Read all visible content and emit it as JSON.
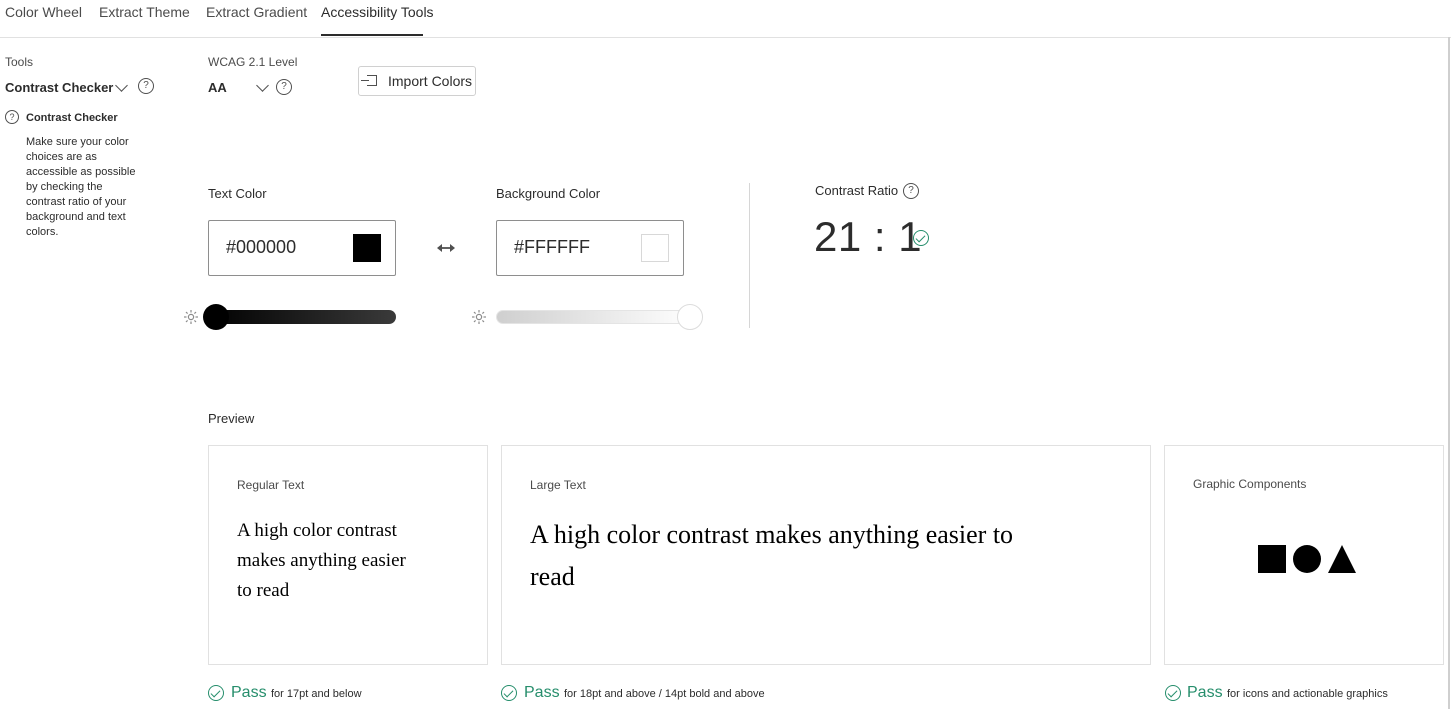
{
  "tabs": [
    {
      "label": "Color Wheel"
    },
    {
      "label": "Extract Theme"
    },
    {
      "label": "Extract Gradient"
    },
    {
      "label": "Accessibility Tools"
    }
  ],
  "active_tab": "Accessibility Tools",
  "tools": {
    "label": "Tools",
    "selected": "Contrast Checker",
    "help_title": "Contrast Checker",
    "description_lines": [
      "Make sure your color",
      "choices are as",
      "accessible as possible",
      "by checking the",
      "contrast ratio of your",
      "background and text",
      "colors."
    ]
  },
  "wcag": {
    "label": "WCAG 2.1 Level",
    "value": "AA"
  },
  "import_button": "Import Colors",
  "text_color": {
    "label": "Text Color",
    "value": "#000000",
    "swatch": "#000000",
    "brightness": 0.0
  },
  "background_color": {
    "label": "Background Color",
    "value": "#FFFFFF",
    "swatch": "#FFFFFF",
    "brightness": 1.0
  },
  "contrast": {
    "label": "Contrast Ratio",
    "value": "21 : 1"
  },
  "preview": {
    "label": "Preview",
    "regular": {
      "title": "Regular Text",
      "sample_lines": [
        "A high color contrast",
        "makes anything easier",
        "to read"
      ],
      "result": "Pass",
      "note": "for 17pt and below"
    },
    "large": {
      "title": "Large Text",
      "sample_lines": [
        "A high color contrast makes anything easier to",
        "read"
      ],
      "result": "Pass",
      "note": "for 18pt and above / 14pt bold and above"
    },
    "graphic": {
      "title": "Graphic Components",
      "shapes": [
        "square",
        "circle",
        "triangle"
      ],
      "result": "Pass",
      "note": "for icons and actionable graphics"
    }
  },
  "colors": {
    "pass": "#268e6c",
    "text": "#2c2c2c",
    "border": "#e1e1e1"
  }
}
